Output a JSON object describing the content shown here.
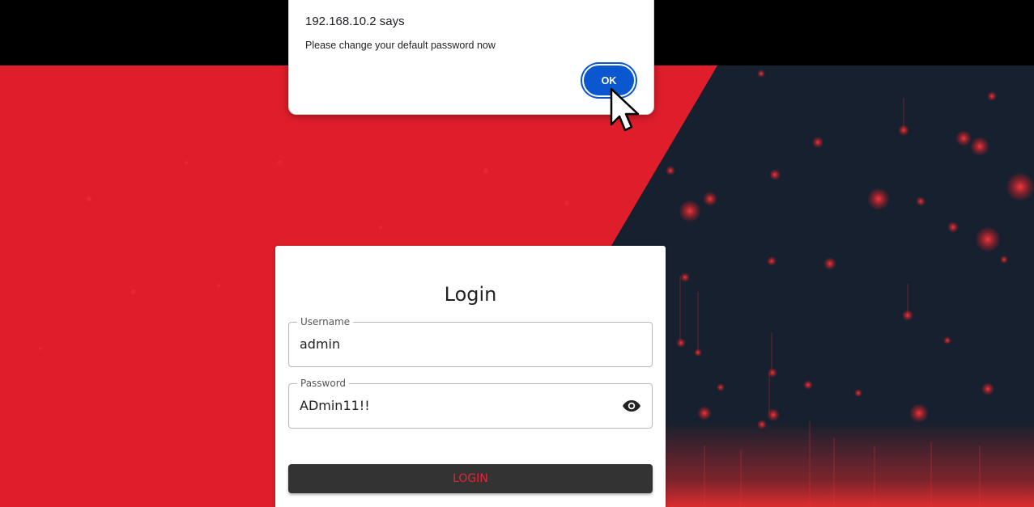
{
  "alert": {
    "title": "192.168.10.2 says",
    "message": "Please change your default password now",
    "ok_label": "OK"
  },
  "login": {
    "title": "Login",
    "username_label": "Username",
    "username_value": "admin",
    "password_label": "Password",
    "password_value": "ADmin11!!",
    "button_label": "LOGIN"
  },
  "colors": {
    "background_red": "#e01e2b",
    "background_dark": "#16202e",
    "ok_button": "#0b57d0",
    "login_button_bg": "#333333",
    "login_button_text": "#e4243a"
  },
  "icons": {
    "password_toggle": "eye-icon",
    "pointer": "cursor-arrow-icon"
  }
}
